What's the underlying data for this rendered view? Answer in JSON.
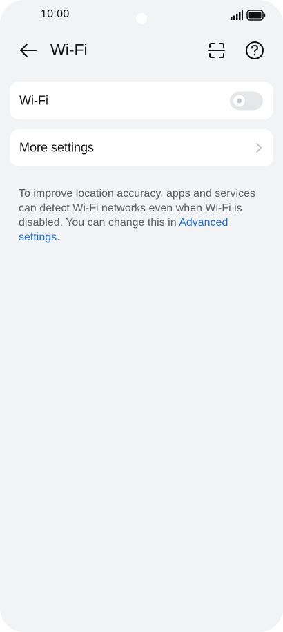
{
  "status_bar": {
    "time": "10:00"
  },
  "header": {
    "title": "Wi-Fi",
    "back_icon": "arrow-left-icon",
    "scan_icon": "scan-icon",
    "help_icon": "help-circle-icon"
  },
  "wifi_card": {
    "label": "Wi-Fi",
    "toggle_on": false
  },
  "more_settings": {
    "label": "More settings"
  },
  "description": {
    "text": "To improve location accuracy, apps and services can detect Wi-Fi networks even when Wi-Fi is disabled. You can change this in ",
    "link_text": "Advanced settings",
    "end": "."
  },
  "colors": {
    "background": "#f1f3f5",
    "card": "#ffffff",
    "link": "#1e6fd9",
    "toggle_off": "#e6e7e9"
  }
}
